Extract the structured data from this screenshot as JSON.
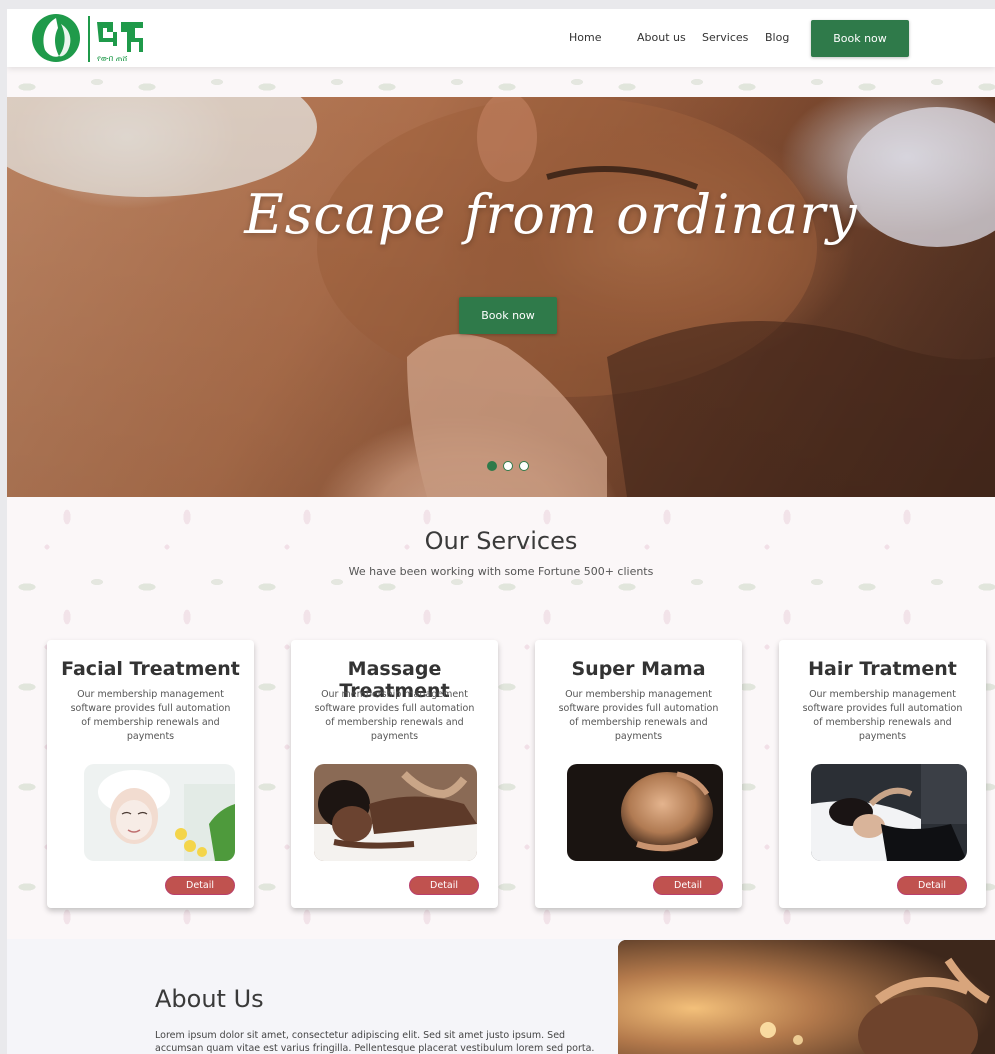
{
  "header": {
    "nav": [
      {
        "label": "Home"
      },
      {
        "label": "About us"
      },
      {
        "label": "Services"
      },
      {
        "label": "Blog"
      }
    ],
    "book_label": "Book now"
  },
  "hero": {
    "title": "Escape from ordinary",
    "book_label": "Book now",
    "slides": 3,
    "active_slide": 1
  },
  "services": {
    "title": "Our Services",
    "subtitle": "We have been working with some Fortune 500+ clients",
    "cards": [
      {
        "title": "Facial Treatment",
        "desc": "Our membership management software provides full automation of membership renewals and payments",
        "button": "Detail"
      },
      {
        "title": "Massage Treatment",
        "desc": "Our membership management software provides full automation of membership renewals and payments",
        "button": "Detail"
      },
      {
        "title": "Super Mama",
        "desc": "Our membership management software provides full automation of membership renewals and payments",
        "button": "Detail"
      },
      {
        "title": "Hair Tratment",
        "desc": "Our membership management software provides full automation of membership renewals and payments",
        "button": "Detail"
      }
    ]
  },
  "about": {
    "title": "About Us",
    "text": "Lorem ipsum dolor sit amet, consectetur adipiscing elit. Sed sit amet justo ipsum. Sed accumsan quam vitae est varius fringilla. Pellentesque placerat vestibulum lorem sed porta."
  },
  "colors": {
    "brand_green": "#2f7a4a",
    "detail_red": "#c0524f"
  }
}
